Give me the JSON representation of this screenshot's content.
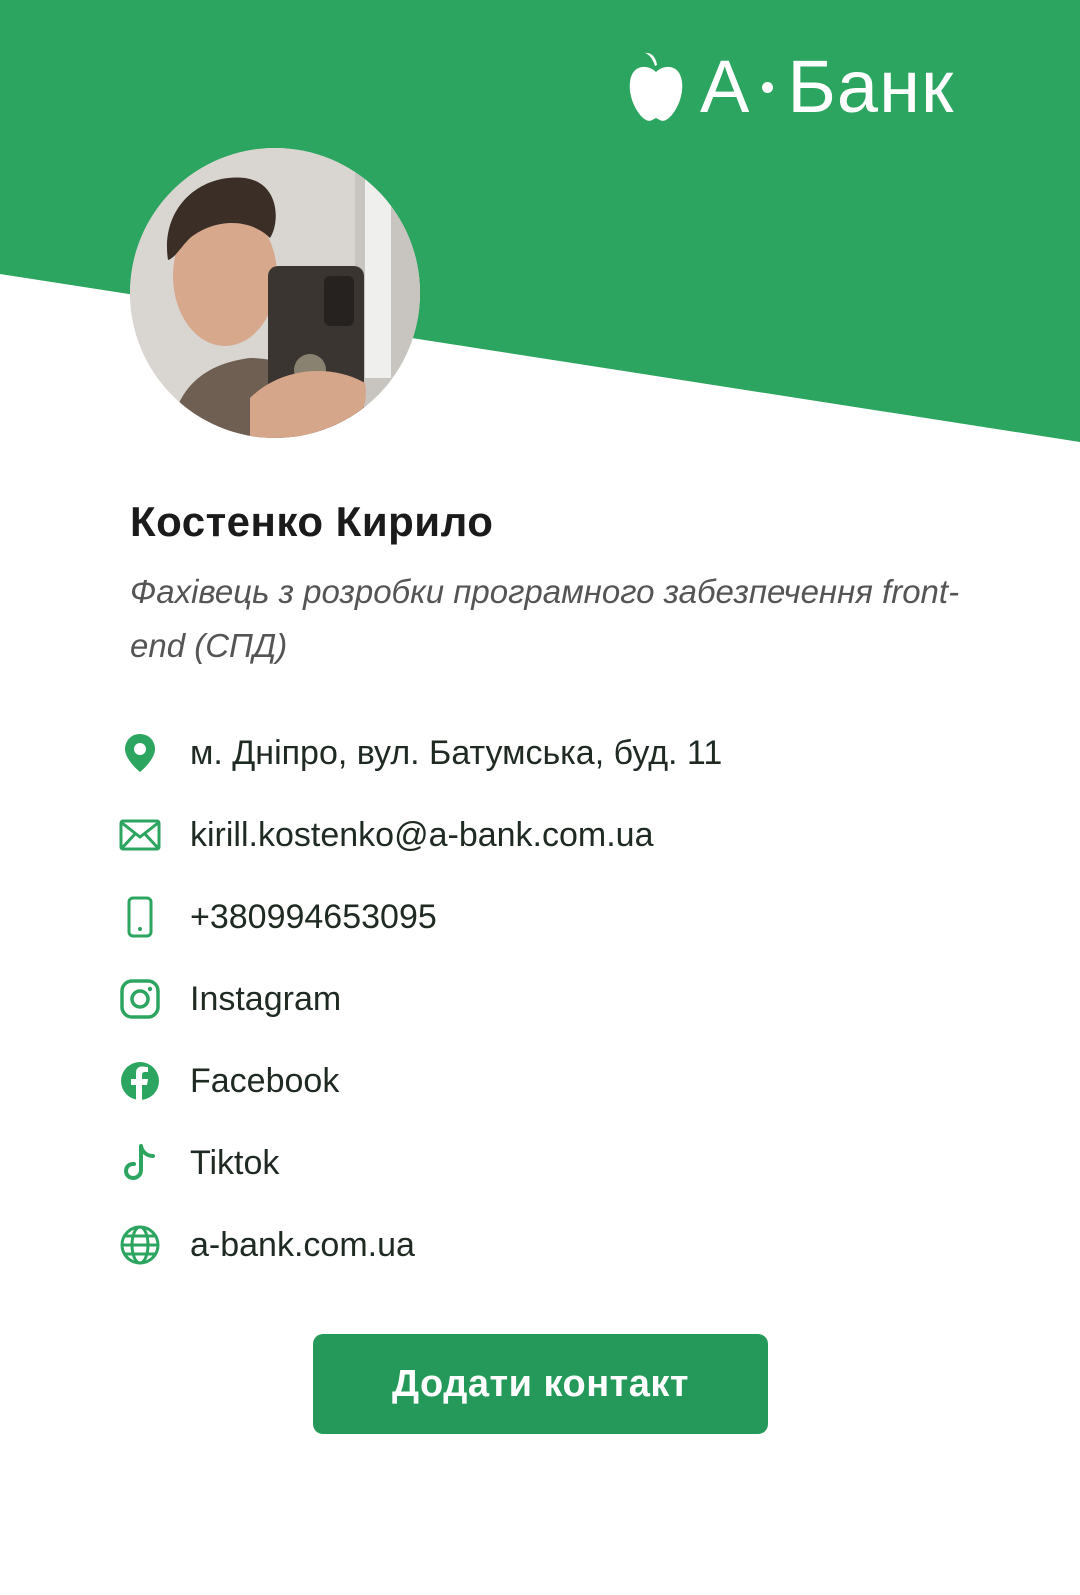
{
  "brand": {
    "logo_letter": "А",
    "logo_word": "Банк",
    "color": "#2ca560"
  },
  "profile": {
    "name": "Костенко Кирило",
    "position": "Фахівець з розробки програмного забезпечення front-end (СПД)"
  },
  "contacts": [
    {
      "icon": "location-pin-icon",
      "text": "м. Дніпро, вул. Батумська, буд. 11"
    },
    {
      "icon": "envelope-icon",
      "text": "kirill.kostenko@a-bank.com.ua"
    },
    {
      "icon": "phone-icon",
      "text": "+380994653095"
    },
    {
      "icon": "instagram-icon",
      "text": "Instagram"
    },
    {
      "icon": "facebook-icon",
      "text": "Facebook"
    },
    {
      "icon": "tiktok-icon",
      "text": "Tiktok"
    },
    {
      "icon": "globe-icon",
      "text": "a-bank.com.ua"
    }
  ],
  "actions": {
    "add_contact_label": "Додати контакт"
  }
}
